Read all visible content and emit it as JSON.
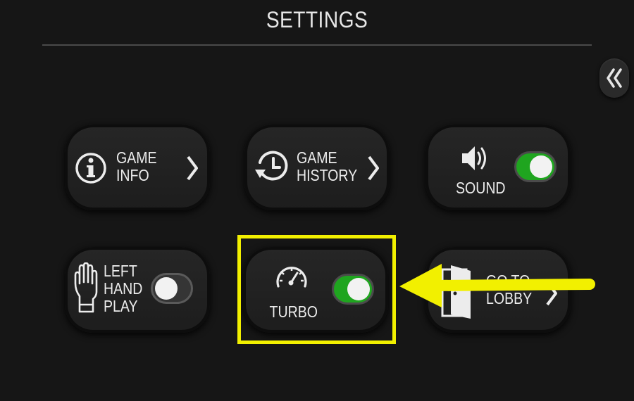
{
  "header": {
    "title": "SETTINGS"
  },
  "collapse_button": {
    "icon": "double-chevron-left-icon"
  },
  "tiles": [
    {
      "line1": "GAME",
      "line2": "INFO",
      "icon": "info-icon"
    },
    {
      "line1": "GAME",
      "line2": "HISTORY",
      "icon": "history-clock-icon"
    },
    {
      "label": "SOUND",
      "icon": "speaker-icon",
      "toggle_state": "on"
    },
    {
      "line1": "LEFT",
      "line2": "HAND",
      "line3": "PLAY",
      "icon": "hand-icon",
      "toggle_state": "off"
    },
    {
      "label": "TURBO",
      "icon": "speedometer-icon",
      "toggle_state": "on"
    },
    {
      "line1": "GO TO",
      "line2": "LOBBY",
      "icon": "exit-door-icon"
    }
  ],
  "annotation": {
    "highlight_color": "#f2f000",
    "arrow_color": "#f2f000"
  },
  "colors": {
    "background": "#161616",
    "toggle_on": "#1fa51f",
    "toggle_off": "#353535"
  }
}
